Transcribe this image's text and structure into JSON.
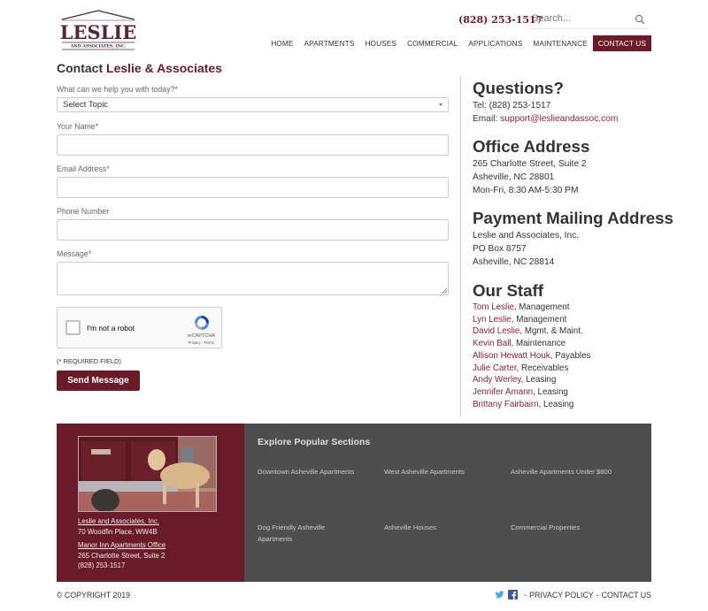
{
  "header": {
    "logo": {
      "name": "LESLIE",
      "tagline": "AND ASSOCIATES, INC."
    },
    "phone": "(828) 253-1517",
    "search_placeholder": "Search...",
    "nav": [
      {
        "label": "HOME",
        "active": false
      },
      {
        "label": "APARTMENTS",
        "active": false
      },
      {
        "label": "HOUSES",
        "active": false
      },
      {
        "label": "COMMERCIAL",
        "active": false
      },
      {
        "label": "APPLICATIONS",
        "active": false
      },
      {
        "label": "MAINTENANCE",
        "active": false
      },
      {
        "label": "CONTACT US",
        "active": true
      }
    ]
  },
  "form": {
    "title_prefix": "Contact",
    "title_accent": "Leslie & Associates",
    "topic_label": "What can we help you with today?*",
    "topic_value": "Select Topic",
    "name_label": "Your Name*",
    "name_value": "",
    "email_label": "Email Address*",
    "email_value": "",
    "phone_label": "Phone Number",
    "phone_value": "",
    "message_label": "Message*",
    "message_value": "",
    "captcha_label": "I'm not a robot",
    "captcha_brand": "reCAPTCHA",
    "captcha_terms": "Privacy - Terms",
    "required_note": "(* REQUIRED FIELD)",
    "submit_label": "Send Message"
  },
  "sidebar": {
    "questions_title": "Questions?",
    "tel": "Tel: (828) 253-1517",
    "email_prefix": "Email: ",
    "email": "support@leslieandassoc.com",
    "office_title": "Office Address",
    "office_lines": [
      "265 Charlotte Street, Suite 2",
      "Asheville, NC 28801",
      "Mon-Fri, 8:30 AM-5:30 PM"
    ],
    "payment_title": "Payment Mailing Address",
    "payment_lines": [
      "Leslie and Associates, Inc.",
      "PO Box 8757",
      "Asheville, NC 28814"
    ],
    "staff_title": "Our Staff",
    "staff": [
      {
        "name": "Tom Leslie",
        "role": ", Management"
      },
      {
        "name": "Lyn Leslie",
        "role": ", Management"
      },
      {
        "name": "David Leslie",
        "role": ", Mgmt. & Maint."
      },
      {
        "name": "Kevin Ball",
        "role": ", Maintenance"
      },
      {
        "name": "Allison Hewatt Houk",
        "role": ", Payables"
      },
      {
        "name": "Julie Carter",
        "role": ", Receivables"
      },
      {
        "name": "Andy Werley",
        "role": ", Leasing"
      },
      {
        "name": "Jennifer Amann",
        "role": ", Leasing"
      },
      {
        "name": "Brittany Fairbairn",
        "role": ", Leasing"
      }
    ]
  },
  "footer": {
    "office1_name": "Leslie and Associates, Inc.",
    "office1_addr": "70 Woodfin Place, WW4B",
    "office2_name": "Manor Inn Apartments Office",
    "office2_addr": "265 Charlotte Street, Suite 2",
    "office2_phone": "(828) 253-1517",
    "popular_title": "Explore Popular Sections",
    "popular": [
      "Downtown Asheville Apartments",
      "West Asheville Apartments",
      "Asheville Apartments Under $800",
      "Dog Friendly Asheville Apartments",
      "Asheville Houses",
      "Commercial Properties"
    ],
    "copyright": "© COPYRIGHT 2019",
    "privacy": "PRIVACY POLICY",
    "contact": "CONTACT US",
    "sep": "-"
  },
  "colors": {
    "brand": "#6b1a2a",
    "link": "#8b2236",
    "footer_dark": "#4e4e4e"
  }
}
